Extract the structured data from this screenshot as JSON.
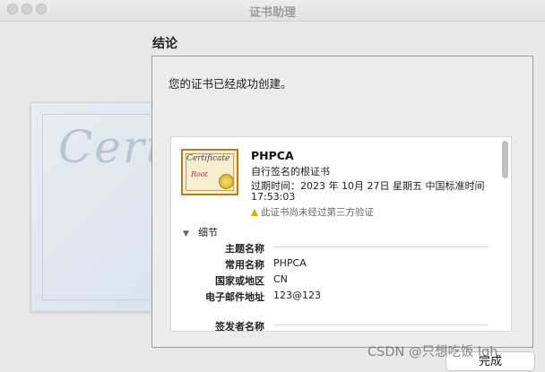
{
  "window": {
    "title": "证书助理"
  },
  "background_art": {
    "text": "Certif"
  },
  "section_title": "结论",
  "message": "您的证书已经成功创建。",
  "certificate": {
    "icon": {
      "word": "Certificate",
      "sub": "Root"
    },
    "name": "PHPCA",
    "type": "自行签名的根证书",
    "expiry_line1": "过期时间：2023 年 10月 27日 星期五 中国标准时间",
    "expiry_line2": "17:53:03",
    "warning": "此证书尚未经过第三方验证"
  },
  "details": {
    "toggle_label": "细节",
    "subject_header": "主题名称",
    "rows": [
      {
        "label": "常用名称",
        "value": "PHPCA"
      },
      {
        "label": "国家或地区",
        "value": "CN"
      },
      {
        "label": "电子邮件地址",
        "value": "123@123"
      }
    ],
    "issuer_header": "签发者名称"
  },
  "buttons": {
    "done": "完成"
  },
  "watermark": "CSDN @只想吃饭 lqh"
}
